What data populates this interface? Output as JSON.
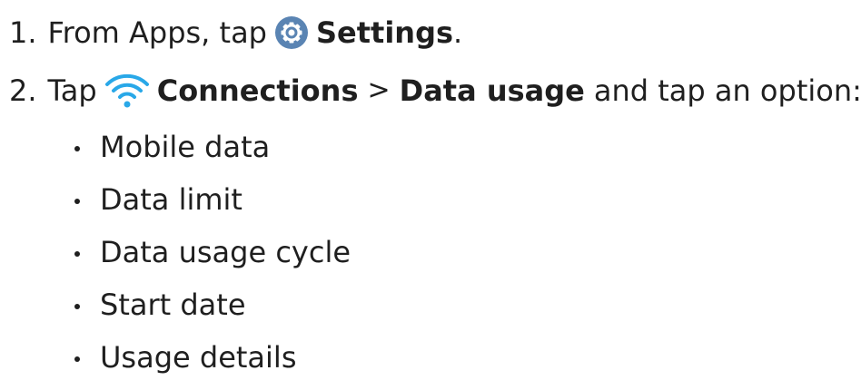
{
  "steps": [
    {
      "number": "1.",
      "text_before": "From Apps, tap",
      "icon": "settings-gear-icon",
      "target": "Settings",
      "text_after": "."
    },
    {
      "number": "2.",
      "text_before": "Tap",
      "icon": "wifi-icon",
      "target": "Connections",
      "separator": ">",
      "target2": "Data usage",
      "text_after": "and tap an option:"
    }
  ],
  "options": [
    "Mobile data",
    "Data limit",
    "Data usage cycle",
    "Start date",
    "Usage details"
  ],
  "colors": {
    "settings_icon_bg": "#5a84b3",
    "wifi_icon": "#29a8e8",
    "text": "#1f1f1f"
  }
}
